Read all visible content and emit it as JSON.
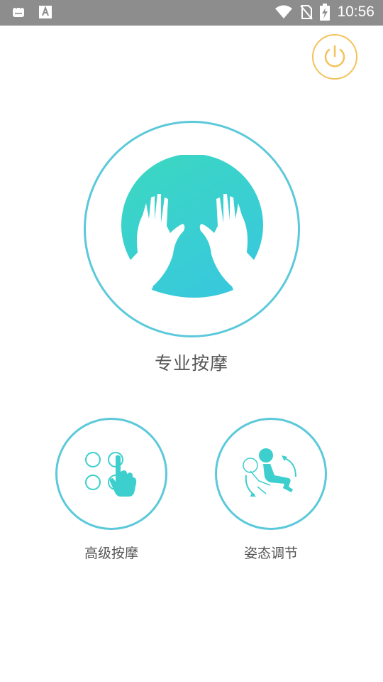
{
  "status_bar": {
    "time": "10:56",
    "left_icons": [
      "android-notification-icon",
      "font-a-icon"
    ],
    "right_icons": [
      "wifi-icon",
      "no-sim-icon",
      "battery-charging-icon"
    ]
  },
  "main": {
    "primary": {
      "label": "专业按摩",
      "icon": "hands-massage-icon"
    },
    "options": [
      {
        "label": "高级按摩",
        "icon": "touch-grid-icon"
      },
      {
        "label": "姿态调节",
        "icon": "posture-adjust-icon"
      }
    ]
  },
  "colors": {
    "accent_teal": "#5cc9da",
    "gradient_start": "#3cd8c0",
    "gradient_end": "#38c9dc",
    "power_ring": "#f4c25a",
    "status_bar_bg": "#8d8d8d"
  }
}
